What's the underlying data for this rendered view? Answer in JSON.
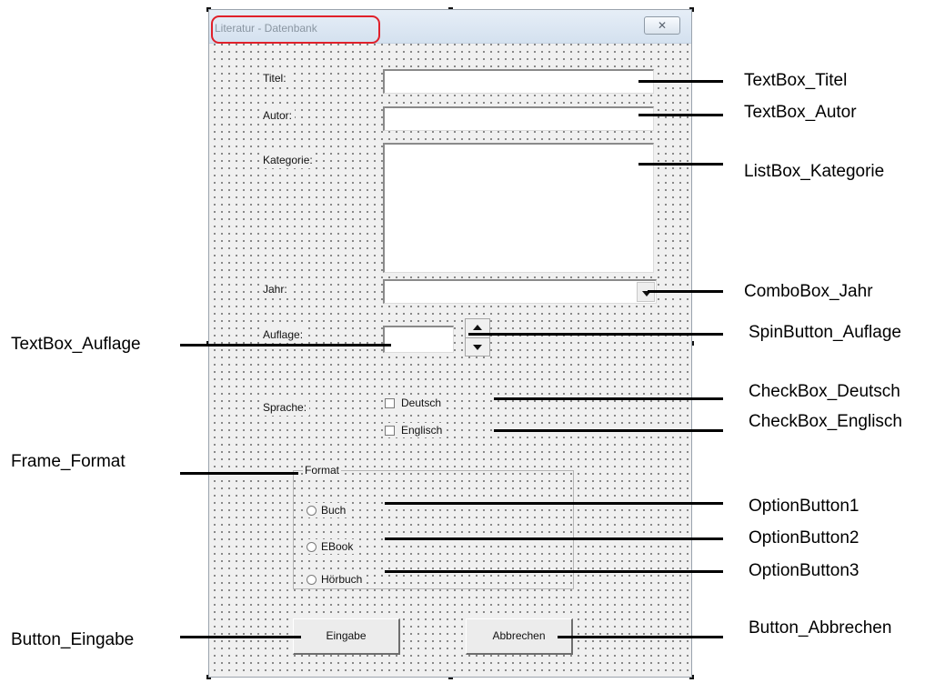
{
  "window": {
    "title": "Literatur - Datenbank",
    "close_glyph": "✕"
  },
  "form": {
    "labels": {
      "titel": "Titel:",
      "autor": "Autor:",
      "kategorie": "Kategorie:",
      "jahr": "Jahr:",
      "auflage": "Auflage:",
      "sprache": "Sprache:"
    },
    "checkboxes": {
      "deutsch": "Deutsch",
      "englisch": "Englisch"
    },
    "frame": {
      "legend": "Format",
      "options": {
        "buch": "Buch",
        "ebook": "EBook",
        "hoerbuch": "Hörbuch"
      }
    },
    "buttons": {
      "eingabe": "Eingabe",
      "abbrechen": "Abbrechen"
    }
  },
  "callouts": {
    "textbox_titel": "TextBox_Titel",
    "textbox_autor": "TextBox_Autor",
    "listbox_kategorie": "ListBox_Kategorie",
    "combobox_jahr": "ComboBox_Jahr",
    "textbox_auflage": "TextBox_Auflage",
    "spinbutton_auflage": "SpinButton_Auflage",
    "checkbox_deutsch": "CheckBox_Deutsch",
    "checkbox_englisch": "CheckBox_Englisch",
    "frame_format": "Frame_Format",
    "optionbutton1": "OptionButton1",
    "optionbutton2": "OptionButton2",
    "optionbutton3": "OptionButton3",
    "button_eingabe": "Button_Eingabe",
    "button_abbrechen": "Button_Abbrechen"
  },
  "colors": {
    "highlight_ring": "#e0202a",
    "form_background": "#f0f0f0",
    "title_text": "#8a96a2"
  }
}
